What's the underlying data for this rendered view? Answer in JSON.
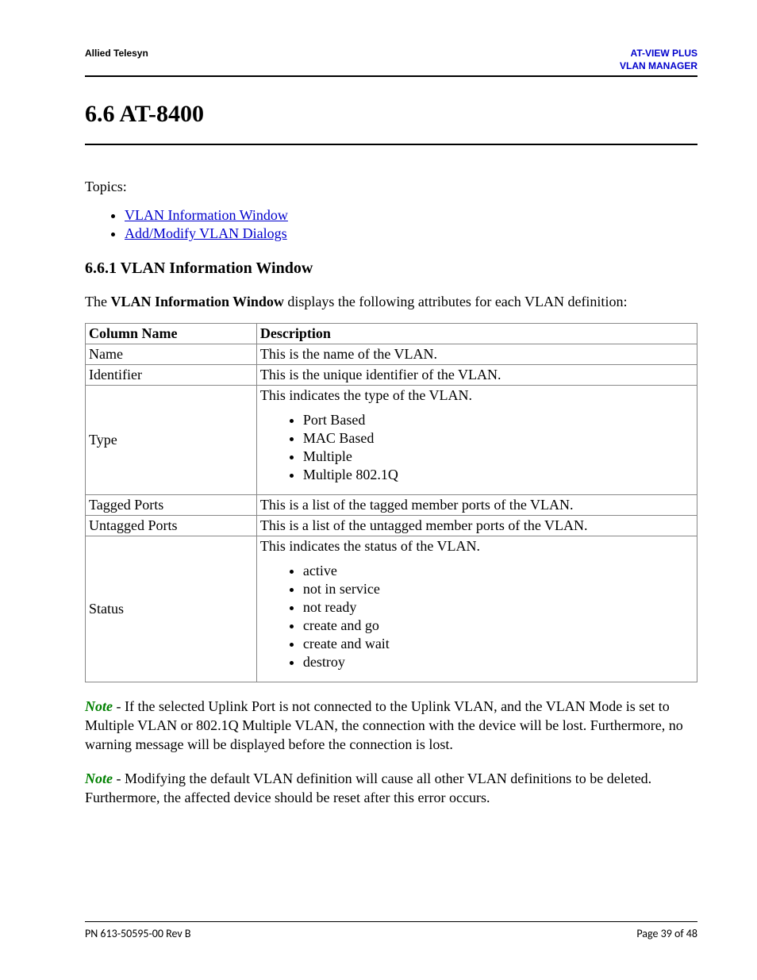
{
  "header": {
    "left": "Allied Telesyn",
    "right_line1": "AT-VIEW PLUS",
    "right_line2": "VLAN MANAGER"
  },
  "title": "6.6 AT-8400",
  "topics_label": "Topics:",
  "topics": [
    "VLAN Information Window",
    "Add/Modify VLAN Dialogs"
  ],
  "subsection_title": "6.6.1 VLAN Information Window",
  "intro_pre": "The ",
  "intro_bold": "VLAN Information Window",
  "intro_post": " displays the following attributes for each VLAN definition:",
  "table": {
    "head_col": "Column Name",
    "head_desc": "Description",
    "rows": [
      {
        "name": "Name",
        "desc": "This is the name of the VLAN."
      },
      {
        "name": "Identifier",
        "desc": "This is the unique identifier of the VLAN."
      },
      {
        "name": "Type",
        "desc_intro": "This indicates the type of the VLAN.",
        "items": [
          "Port Based",
          "MAC Based",
          "Multiple",
          "Multiple 802.1Q"
        ]
      },
      {
        "name": "Tagged Ports",
        "desc": "This is a list of the tagged member ports of the VLAN."
      },
      {
        "name": "Untagged Ports",
        "desc": "This is a list of the untagged member ports of the VLAN."
      },
      {
        "name": "Status",
        "desc_intro": "This indicates the status of the VLAN.",
        "items": [
          "active",
          "not in service",
          "not ready",
          "create and go",
          "create and wait",
          "destroy"
        ]
      }
    ]
  },
  "note_label": "Note",
  "note1": " - If the selected Uplink Port is not connected to the Uplink VLAN, and the VLAN Mode is set to Multiple VLAN or 802.1Q Multiple VLAN, the connection with the device will be lost. Furthermore, no warning message will be displayed before the connection is lost.",
  "note2": " - Modifying the default VLAN definition will cause all other VLAN definitions to be deleted. Furthermore, the affected device should be reset after this error occurs.",
  "footer": {
    "left": "PN 613-50595-00 Rev B",
    "right": "Page 39 of 48"
  }
}
